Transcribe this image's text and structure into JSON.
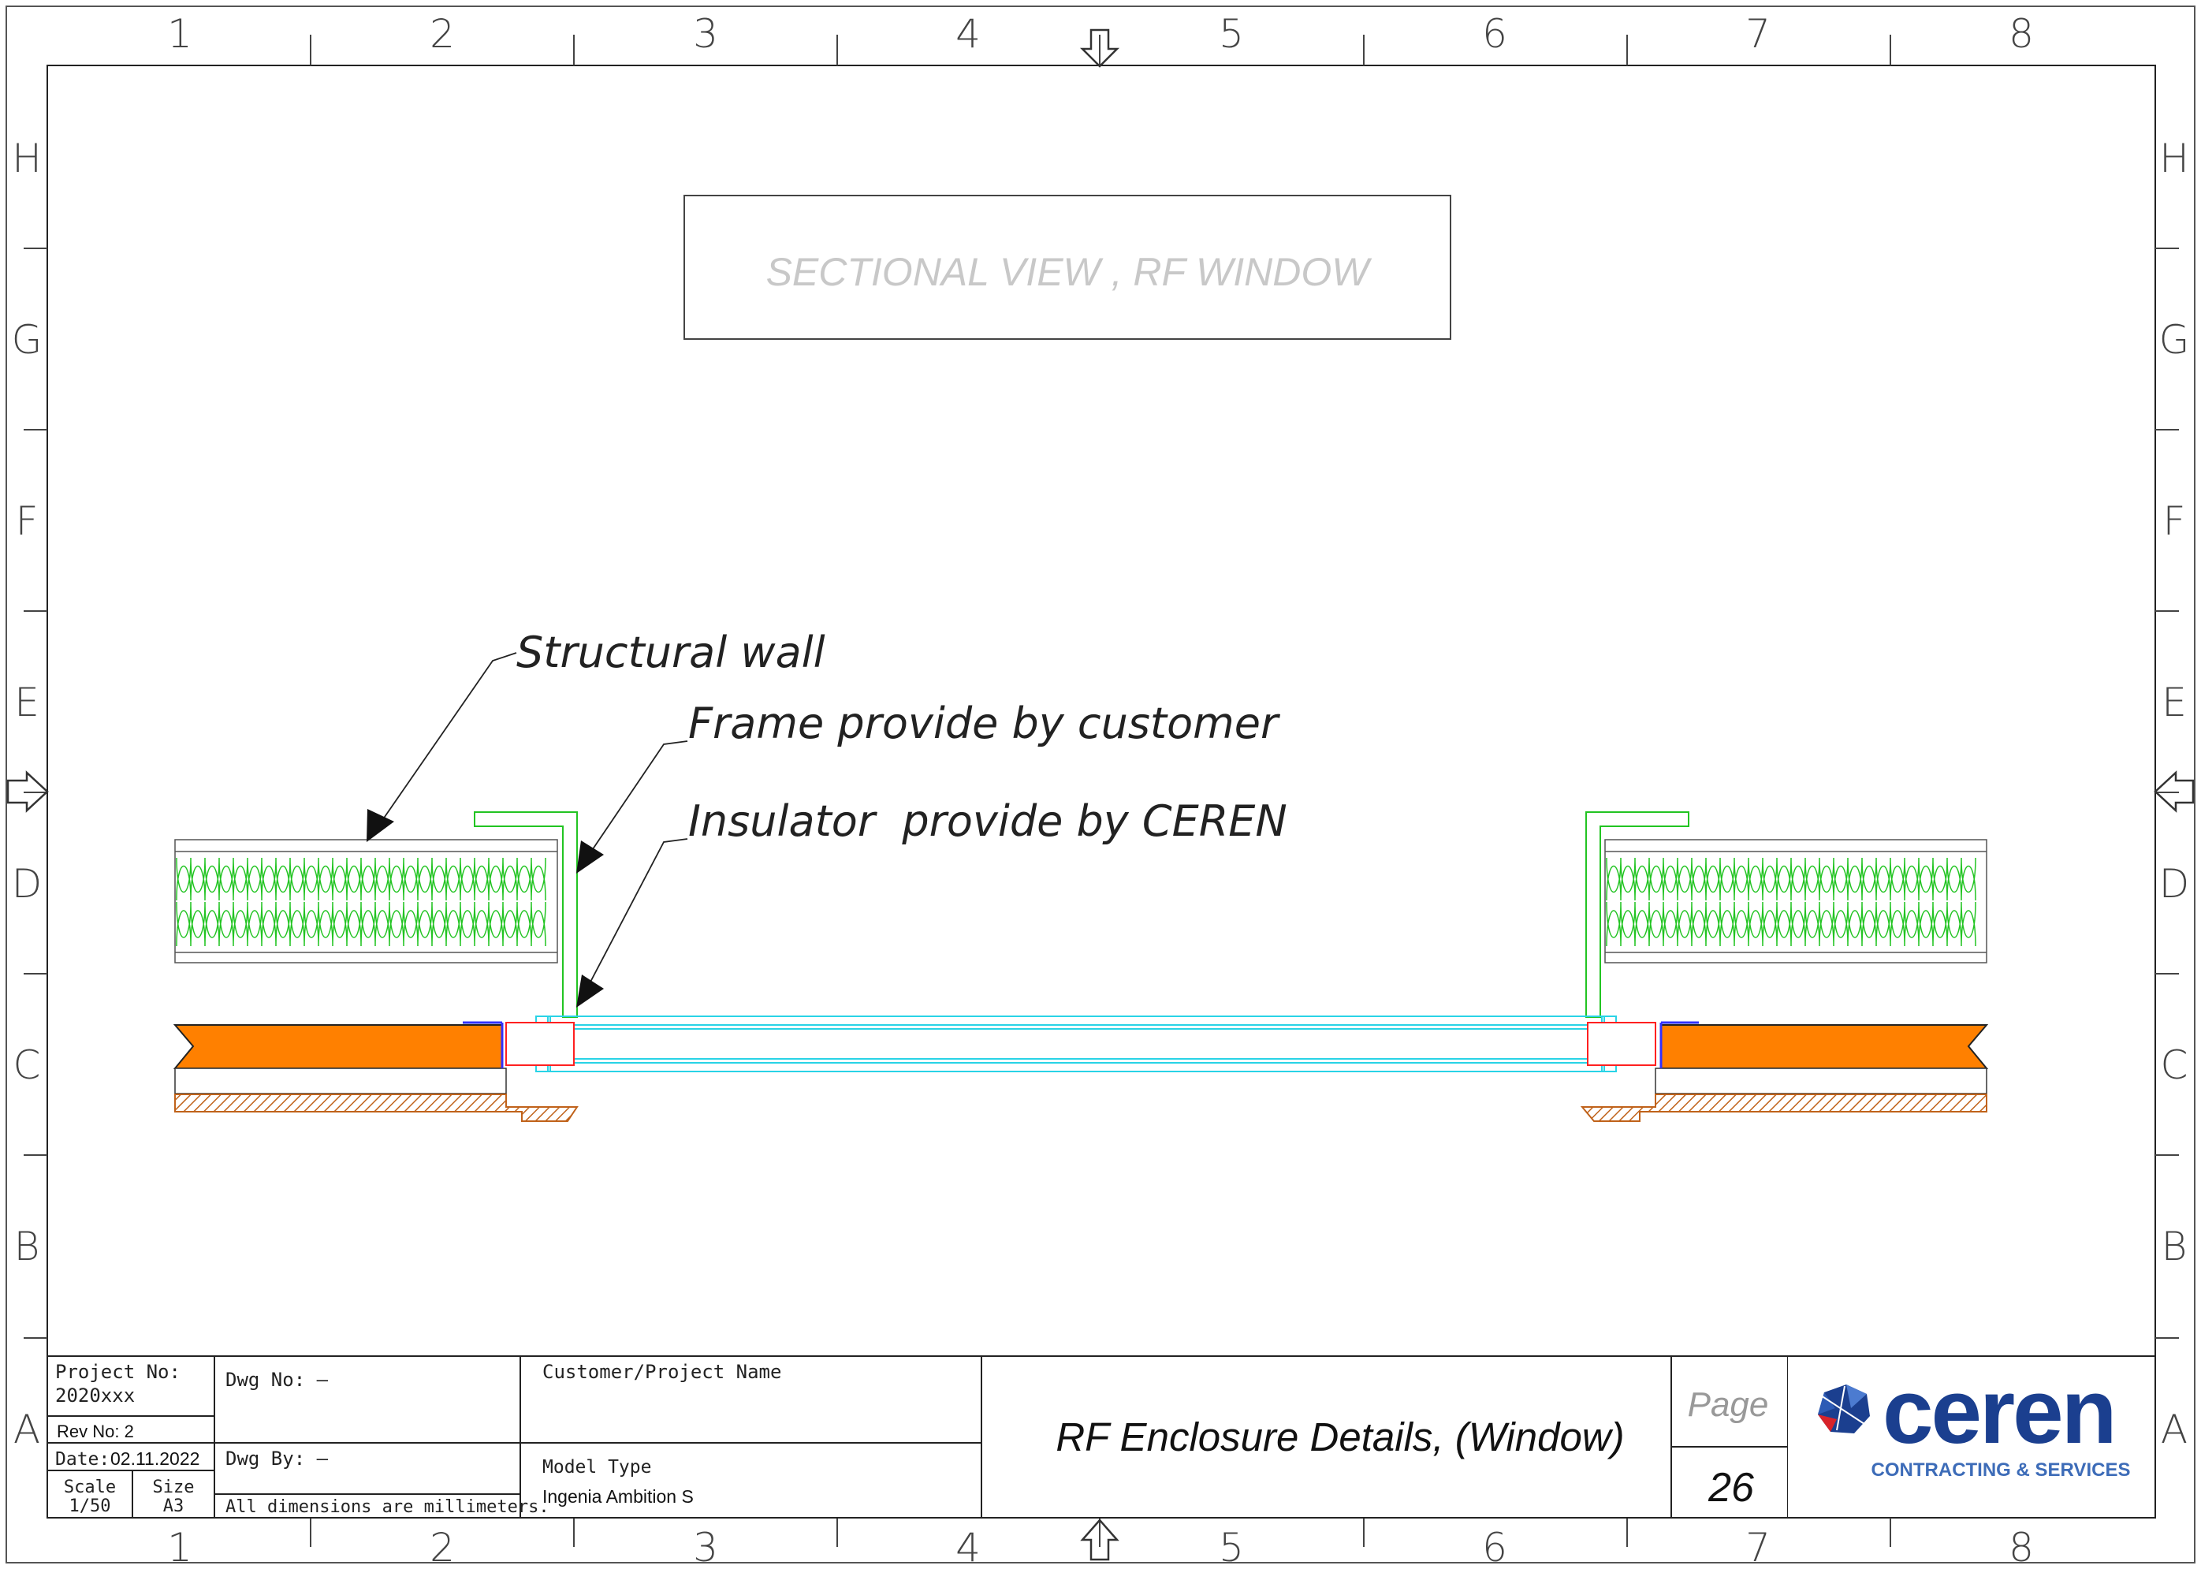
{
  "grid": {
    "columns": [
      "1",
      "2",
      "3",
      "4",
      "5",
      "6",
      "7",
      "8"
    ],
    "rows": [
      "H",
      "G",
      "F",
      "E",
      "D",
      "C",
      "B",
      "A"
    ]
  },
  "view_title": "SECTIONAL VIEW ,   RF WINDOW",
  "callouts": {
    "structural_wall": "Structural wall",
    "frame": "Frame provide by customer",
    "insulator": "Insulator  provide by CEREN"
  },
  "title_block": {
    "project_no_label": "Project No:",
    "project_no": "2020xxx",
    "rev_no": "Rev No: 2",
    "date_label": "Date:",
    "date": "02.11.2022",
    "scale_label": "Scale",
    "scale": "1/50",
    "size_label": "Size",
    "size": "A3",
    "dwg_no": "Dwg No: –",
    "dwg_by": "Dwg By: –",
    "dimensions_note": "All dimensions are millimeters.",
    "customer_label": "Customer/Project Name",
    "model_type_label": "Model Type",
    "model_type": "Ingenia Ambition S",
    "drawing_title": "RF Enclosure Details, (Window)",
    "page_label": "Page",
    "page_number": "26"
  },
  "logo": {
    "wordmark": "ceren",
    "tagline": "CONTRACTING & SERVICES"
  },
  "colors": {
    "insulation": "#22c422",
    "glass": "#29d3e6",
    "orange_panel": "#ff8000",
    "hatch": "#c0621a",
    "insulator": "#ff2020",
    "logo_blue": "#1b3f8f",
    "title_gray": "#c8c8c8"
  }
}
